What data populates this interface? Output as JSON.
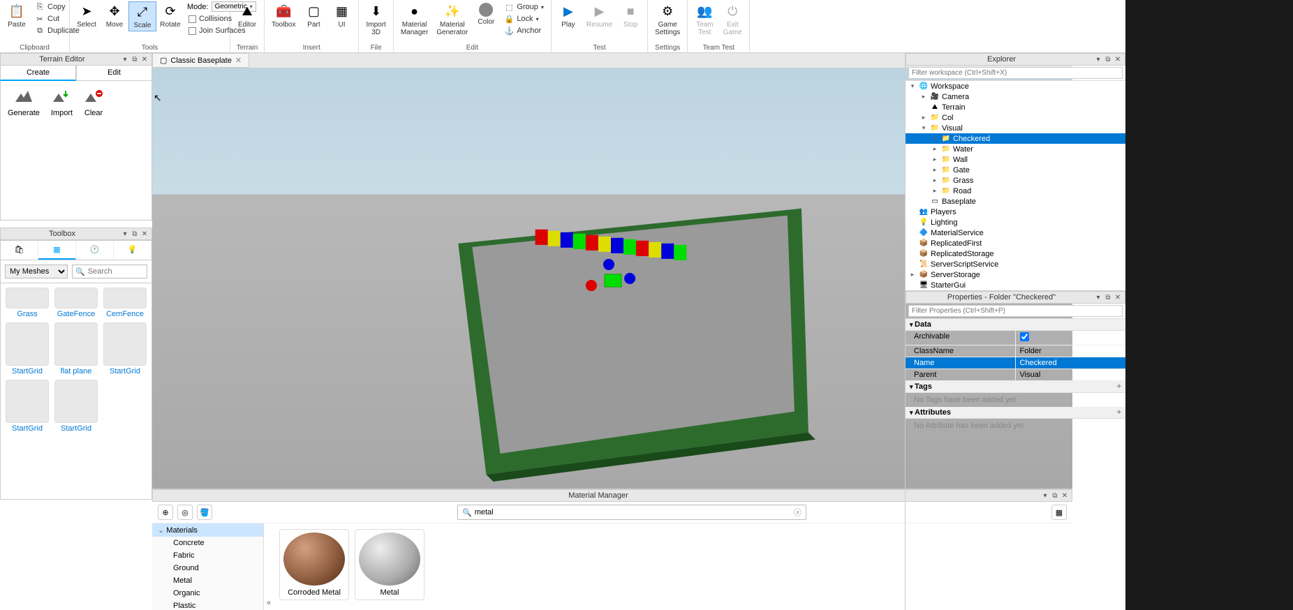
{
  "ribbon": {
    "clipboard": {
      "label": "Clipboard",
      "paste": "Paste",
      "copy": "Copy",
      "cut": "Cut",
      "duplicate": "Duplicate"
    },
    "tools": {
      "label": "Tools",
      "select": "Select",
      "move": "Move",
      "scale": "Scale",
      "rotate": "Rotate",
      "mode": "Mode:",
      "mode_val": "Geometric",
      "collisions": "Collisions",
      "join": "Join Surfaces"
    },
    "terrain": {
      "label": "Terrain",
      "editor": "Editor"
    },
    "insert": {
      "label": "Insert",
      "toolbox": "Toolbox",
      "part": "Part",
      "ui": "UI"
    },
    "file": {
      "label": "File",
      "import": "Import\n3D"
    },
    "edit": {
      "label": "Edit",
      "matsvc": "Material\nManager",
      "matgen": "Material\nGenerator",
      "color": "Color",
      "group": "Group",
      "lock": "Lock",
      "anchor": "Anchor"
    },
    "test": {
      "label": "Test",
      "play": "Play",
      "resume": "Resume",
      "stop": "Stop"
    },
    "settings": {
      "label": "Settings",
      "game": "Game\nSettings"
    },
    "teamtest": {
      "label": "Team Test",
      "team": "Team\nTest",
      "exit": "Exit\nGame"
    }
  },
  "left": {
    "terrain_title": "Terrain Editor",
    "create": "Create",
    "edit": "Edit",
    "generate": "Generate",
    "import": "Import",
    "clear": "Clear",
    "toolbox_title": "Toolbox",
    "toolbox_dropdown": "My Meshes",
    "toolbox_search": "Search",
    "items": [
      "Grass",
      "GateFence",
      "CemFence",
      "StartGrid",
      "flat plane",
      "StartGrid",
      "StartGrid",
      "StartGrid"
    ]
  },
  "tabs": {
    "scene": "Classic Baseplate"
  },
  "material": {
    "title": "Material Manager",
    "search": "metal",
    "tree": [
      "Materials",
      "Concrete",
      "Fabric",
      "Ground",
      "Metal",
      "Organic",
      "Plastic"
    ],
    "items": [
      "Corroded Metal",
      "Metal"
    ]
  },
  "explorer": {
    "title": "Explorer",
    "filter": "Filter workspace (Ctrl+Shift+X)",
    "tree": [
      {
        "d": 0,
        "exp": "▾",
        "icon": "🌐",
        "name": "Workspace"
      },
      {
        "d": 1,
        "exp": "▸",
        "icon": "🎥",
        "name": "Camera"
      },
      {
        "d": 1,
        "exp": "",
        "icon": "⛰",
        "name": "Terrain"
      },
      {
        "d": 1,
        "exp": "▸",
        "icon": "📁",
        "name": "Col"
      },
      {
        "d": 1,
        "exp": "▾",
        "icon": "📁",
        "name": "Visual"
      },
      {
        "d": 2,
        "exp": "▸",
        "icon": "📁",
        "name": "Checkered",
        "sel": true
      },
      {
        "d": 2,
        "exp": "▸",
        "icon": "📁",
        "name": "Water"
      },
      {
        "d": 2,
        "exp": "▸",
        "icon": "📁",
        "name": "Wall"
      },
      {
        "d": 2,
        "exp": "▸",
        "icon": "📁",
        "name": "Gate"
      },
      {
        "d": 2,
        "exp": "▸",
        "icon": "📁",
        "name": "Grass"
      },
      {
        "d": 2,
        "exp": "▸",
        "icon": "📁",
        "name": "Road"
      },
      {
        "d": 1,
        "exp": "",
        "icon": "▭",
        "name": "Baseplate"
      },
      {
        "d": 0,
        "exp": "",
        "icon": "👥",
        "name": "Players"
      },
      {
        "d": 0,
        "exp": "",
        "icon": "💡",
        "name": "Lighting"
      },
      {
        "d": 0,
        "exp": "",
        "icon": "🔷",
        "name": "MaterialService"
      },
      {
        "d": 0,
        "exp": "",
        "icon": "📦",
        "name": "ReplicatedFirst"
      },
      {
        "d": 0,
        "exp": "",
        "icon": "📦",
        "name": "ReplicatedStorage"
      },
      {
        "d": 0,
        "exp": "",
        "icon": "📜",
        "name": "ServerScriptService"
      },
      {
        "d": 0,
        "exp": "▸",
        "icon": "📦",
        "name": "ServerStorage"
      },
      {
        "d": 0,
        "exp": "",
        "icon": "🖥",
        "name": "StarterGui"
      }
    ]
  },
  "properties": {
    "title": "Properties - Folder \"Checkered\"",
    "filter": "Filter Properties (Ctrl+Shift+P)",
    "sections": {
      "data": "Data",
      "tags": "Tags",
      "attributes": "Attributes"
    },
    "rows": [
      {
        "k": "Archivable",
        "v": "✓"
      },
      {
        "k": "ClassName",
        "v": "Folder"
      },
      {
        "k": "Name",
        "v": "Checkered",
        "sel": true
      },
      {
        "k": "Parent",
        "v": "Visual"
      }
    ],
    "no_tags": "No Tags have been added yet",
    "no_attrs": "No Attribute has been added yet"
  }
}
